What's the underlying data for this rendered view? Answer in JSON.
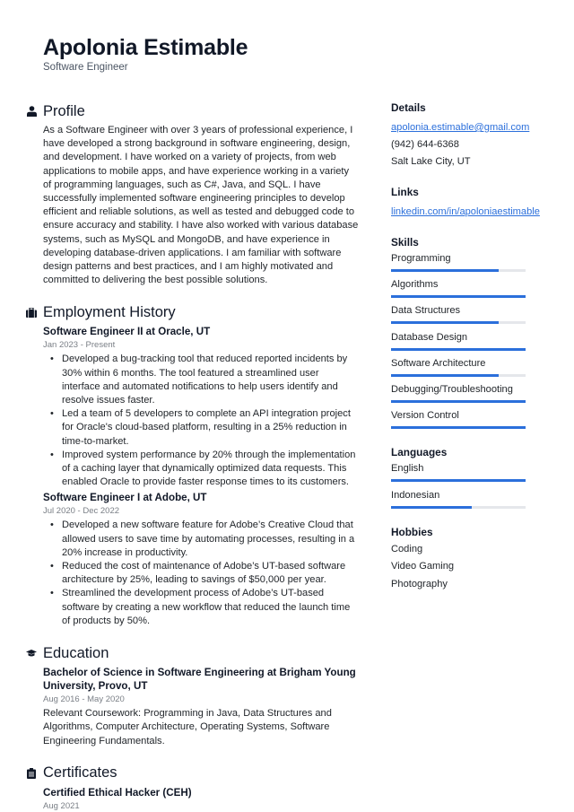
{
  "header": {
    "name": "Apolonia Estimable",
    "title": "Software Engineer"
  },
  "profile": {
    "heading": "Profile",
    "icon": "person-icon",
    "text": "As a Software Engineer with over 3 years of professional experience, I have developed a strong background in software engineering, design, and development. I have worked on a variety of projects, from web applications to mobile apps, and have experience working in a variety of programming languages, such as C#, Java, and SQL. I have successfully implemented software engineering principles to develop efficient and reliable solutions, as well as tested and debugged code to ensure accuracy and stability. I have also worked with various database systems, such as MySQL and MongoDB, and have experience in developing database-driven applications. I am familiar with software design patterns and best practices, and I am highly motivated and committed to delivering the best possible solutions."
  },
  "employment": {
    "heading": "Employment History",
    "icon": "briefcase-icon",
    "jobs": [
      {
        "title": "Software Engineer II at Oracle, UT",
        "date": "Jan 2023 - Present",
        "bullets": [
          "Developed a bug-tracking tool that reduced reported incidents by 30% within 6 months. The tool featured a streamlined user interface and automated notifications to help users identify and resolve issues faster.",
          "Led a team of 5 developers to complete an API integration project for Oracle's cloud-based platform, resulting in a 25% reduction in time-to-market.",
          "Improved system performance by 20% through the implementation of a caching layer that dynamically optimized data requests. This enabled Oracle to provide faster response times to its customers."
        ]
      },
      {
        "title": "Software Engineer I at Adobe, UT",
        "date": "Jul 2020 - Dec 2022",
        "bullets": [
          "Developed a new software feature for Adobe’s Creative Cloud that allowed users to save time by automating processes, resulting in a 20% increase in productivity.",
          "Reduced the cost of maintenance of Adobe’s UT-based software architecture by 25%, leading to savings of $50,000 per year.",
          "Streamlined the development process of Adobe’s UT-based software by creating a new workflow that reduced the launch time of products by 50%."
        ]
      }
    ]
  },
  "education": {
    "heading": "Education",
    "icon": "graduation-cap-icon",
    "items": [
      {
        "title": "Bachelor of Science in Software Engineering at Brigham Young University, Provo, UT",
        "date": "Aug 2016 - May 2020",
        "text": "Relevant Coursework: Programming in Java, Data Structures and Algorithms, Computer Architecture, Operating Systems, Software Engineering Fundamentals."
      }
    ]
  },
  "certificates": {
    "heading": "Certificates",
    "icon": "clipboard-icon",
    "items": [
      {
        "title": "Certified Ethical Hacker (CEH)",
        "date": "Aug 2021"
      }
    ]
  },
  "details": {
    "heading": "Details",
    "email": "apolonia.estimable@gmail.com",
    "phone": "(942) 644-6368",
    "location": "Salt Lake City, UT"
  },
  "links": {
    "heading": "Links",
    "items": [
      "linkedin.com/in/apoloniaestimable"
    ]
  },
  "skills": {
    "heading": "Skills",
    "accent_color": "#2b6fdb",
    "items": [
      {
        "label": "Programming",
        "level": 0.8
      },
      {
        "label": "Algorithms",
        "level": 1.0
      },
      {
        "label": "Data Structures",
        "level": 0.8
      },
      {
        "label": "Database Design",
        "level": 1.0
      },
      {
        "label": "Software Architecture",
        "level": 0.8
      },
      {
        "label": "Debugging/Troubleshooting",
        "level": 1.0
      },
      {
        "label": "Version Control",
        "level": 1.0
      }
    ]
  },
  "languages": {
    "heading": "Languages",
    "items": [
      {
        "label": "English",
        "level": 1.0
      },
      {
        "label": "Indonesian",
        "level": 0.6
      }
    ]
  },
  "hobbies": {
    "heading": "Hobbies",
    "items": [
      "Coding",
      "Video Gaming",
      "Photography"
    ]
  }
}
